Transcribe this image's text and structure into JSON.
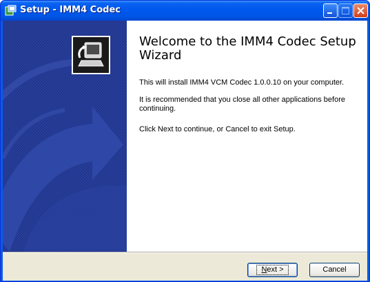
{
  "window": {
    "title": "Setup - IMM4 Codec",
    "title_icon": "setup-installer-icon"
  },
  "titlebar_buttons": [
    "minimize",
    "maximize",
    "close"
  ],
  "wizard": {
    "heading": "Welcome to the IMM4 Codec Setup Wizard",
    "paragraphs": [
      "This will install IMM4 VCM Codec 1.0.0.10 on your computer.",
      "It is recommended that you close all other applications before continuing.",
      "Click Next to continue, or Cancel to exit Setup."
    ]
  },
  "buttons": {
    "next_mnemonic": "N",
    "next_rest": "ext >",
    "cancel": "Cancel"
  },
  "colors": {
    "titlebar": "#0058ee",
    "side_panel": "#1f3590",
    "dialog_bg": "#ece9d8",
    "close_button": "#d13e1b"
  }
}
